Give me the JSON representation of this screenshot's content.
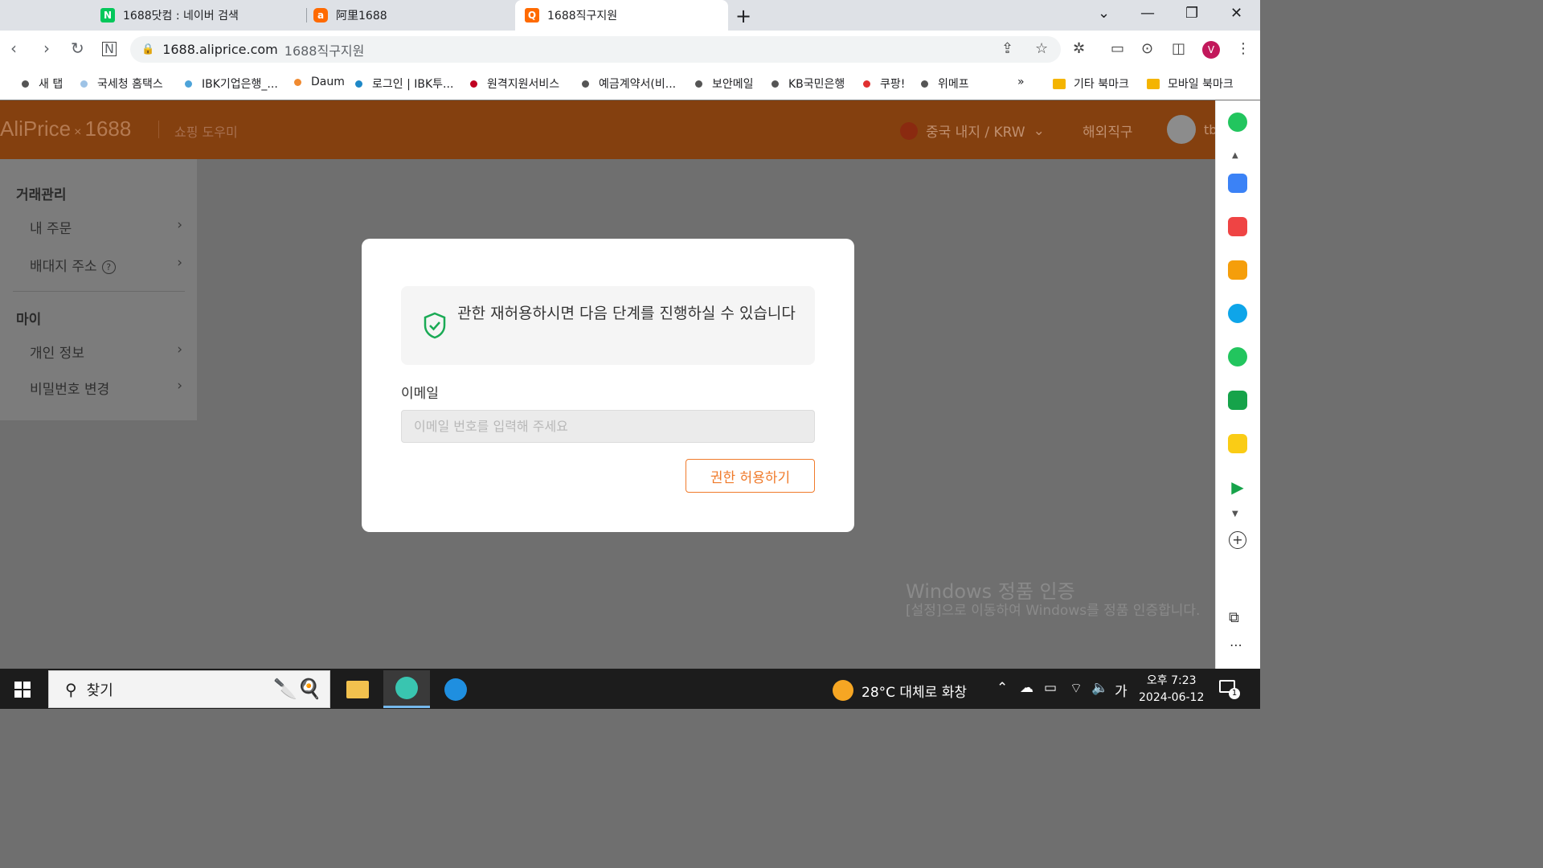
{
  "browser": {
    "tabs": [
      {
        "label": "1688닷컴 : 네이버 검색",
        "favicon": "N",
        "color": "#03c75a"
      },
      {
        "label": "阿里1688",
        "favicon": "a",
        "color": "#ff6a00"
      },
      {
        "label": "1688직구지원",
        "favicon": "Q",
        "color": "#ff6a00"
      }
    ],
    "url": "1688.aliprice.com",
    "page_title": "1688직구지원",
    "profile_initial": "V",
    "bookmarks": [
      {
        "label": "새 탭",
        "color": "#555555"
      },
      {
        "label": "국세청 홈택스",
        "color": "#9ec3e6"
      },
      {
        "label": "IBK기업은행_...",
        "color": "#4da3d9"
      },
      {
        "label": "Daum",
        "color": "#f08a30"
      },
      {
        "label": "로그인 | IBK투...",
        "color": "#1e88c7"
      },
      {
        "label": "원격지원서비스",
        "color": "#c00020"
      },
      {
        "label": "예금계약서(비...",
        "color": "#555555"
      },
      {
        "label": "보안메일",
        "color": "#555555"
      },
      {
        "label": "KB국민은행",
        "color": "#555555"
      },
      {
        "label": "쿠팡!",
        "color": "#e03030"
      },
      {
        "label": "위메프",
        "color": "#555555"
      }
    ],
    "bookmark_folders": [
      "기타 북마크",
      "모바일 북마크"
    ]
  },
  "header": {
    "logo_left": "AliPrice",
    "logo_x": "×",
    "logo_right": "1688",
    "tagline": "쇼핑 도우미",
    "region": "중국 내지 / KRW",
    "overseas": "해외직구",
    "username": "tb"
  },
  "sidebar": {
    "section1": "거래관리",
    "items1": [
      "내 주문",
      "배대지 주소"
    ],
    "section2": "마이",
    "items2": [
      "개인 정보",
      "비밀번호 변경"
    ],
    "help_glyph": "?"
  },
  "dialog": {
    "notice": "관한 재허용하시면 다음 단계를 진행하실 수 있습니다",
    "email_label": "이메일",
    "email_placeholder": "이메일 번호를 입력해 주세요",
    "email_value": "",
    "button": "권한 허용하기",
    "accent": "#f07a2a"
  },
  "watermark": {
    "title": "Windows 정품 인증",
    "subtitle": "[설정]으로 이동하여 Windows를 정품 인증합니다."
  },
  "taskbar": {
    "search_label": "찾기",
    "weather": "28°C  대체로 화창",
    "ime": "가",
    "time": "오후 7:23",
    "date": "2024-06-12",
    "notification_count": "1"
  }
}
